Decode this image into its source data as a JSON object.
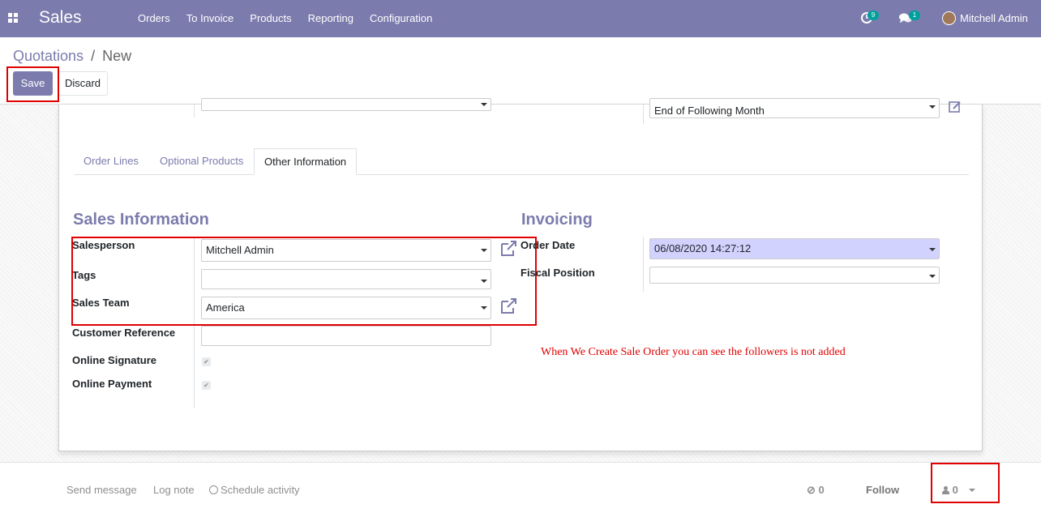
{
  "topbar": {
    "app_name": "Sales",
    "menu": [
      "Orders",
      "To Invoice",
      "Products",
      "Reporting",
      "Configuration"
    ],
    "activity_count": "9",
    "message_count": "1",
    "user_name": "Mitchell Admin"
  },
  "breadcrumb": {
    "parent": "Quotations",
    "separator": "/",
    "current": "New"
  },
  "buttons": {
    "save": "Save",
    "discard": "Discard"
  },
  "partial_fields": {
    "payment_terms_value": "End of Following Month"
  },
  "tabs": [
    {
      "label": "Order Lines",
      "active": false
    },
    {
      "label": "Optional Products",
      "active": false
    },
    {
      "label": "Other Information",
      "active": true
    }
  ],
  "sales_info": {
    "title": "Sales Information",
    "salesperson_label": "Salesperson",
    "salesperson_value": "Mitchell Admin",
    "tags_label": "Tags",
    "tags_value": "",
    "sales_team_label": "Sales Team",
    "sales_team_value": "America",
    "customer_ref_label": "Customer Reference",
    "customer_ref_value": "",
    "online_signature_label": "Online Signature",
    "online_signature_checked": true,
    "online_payment_label": "Online Payment",
    "online_payment_checked": true
  },
  "invoicing": {
    "title": "Invoicing",
    "order_date_label": "Order Date",
    "order_date_value": "06/08/2020 14:27:12",
    "fiscal_position_label": "Fiscal Position",
    "fiscal_position_value": ""
  },
  "annotation": "When We Create Sale Order you can see the followers is not added",
  "chatter": {
    "send_message": "Send message",
    "log_note": "Log note",
    "schedule_activity": "Schedule activity",
    "attachments_count": "0",
    "follow": "Follow",
    "followers_count": "0"
  },
  "colors": {
    "primary": "#7c7bad",
    "highlight": "#e00000",
    "badge": "#00a09d",
    "date_bg": "#d2d2ff"
  }
}
